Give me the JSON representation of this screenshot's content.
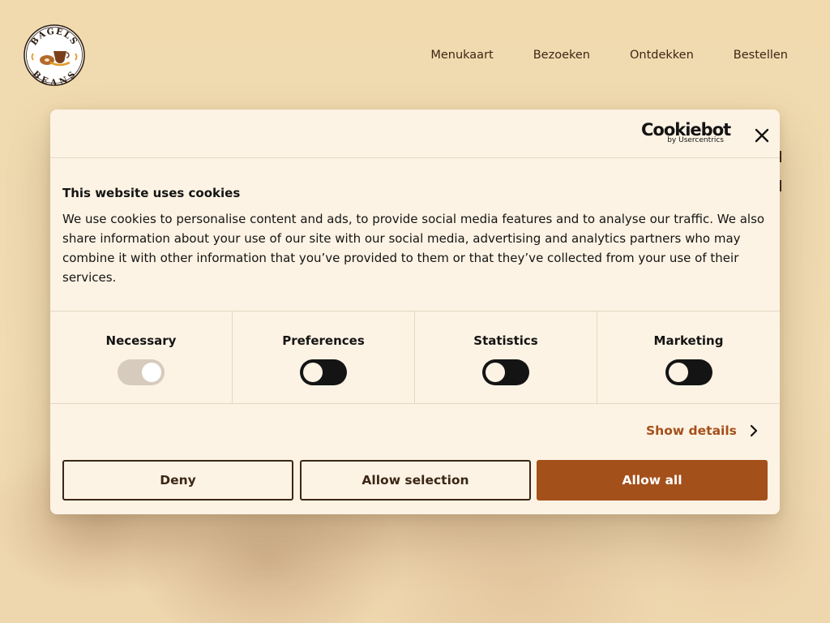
{
  "site": {
    "logo_text_top": "BAGELS",
    "logo_text_bottom": "BEANS",
    "nav": [
      "Menukaart",
      "Bezoeken",
      "Ontdekken",
      "Bestellen"
    ]
  },
  "dialog": {
    "provider_name": "Cookiebot",
    "provider_sub": "by Usercentrics",
    "title": "This website uses cookies",
    "description": "We use cookies to personalise content and ads, to provide social media features and to analyse our traffic. We also share information about your use of our site with our social media, advertising and analytics partners who may combine it with other information that you’ve provided to them or that they’ve collected from your use of their services.",
    "categories": [
      {
        "label": "Necessary",
        "checked": true,
        "disabled": true
      },
      {
        "label": "Preferences",
        "checked": false,
        "disabled": false
      },
      {
        "label": "Statistics",
        "checked": false,
        "disabled": false
      },
      {
        "label": "Marketing",
        "checked": false,
        "disabled": false
      }
    ],
    "show_details": "Show details",
    "buttons": {
      "deny": "Deny",
      "allow_selection": "Allow selection",
      "allow_all": "Allow all"
    }
  },
  "colors": {
    "page_bg": "#f1dcb1",
    "dialog_bg": "#fdf3e4",
    "accent": "#a4501b",
    "text_dark": "#3b2616"
  },
  "icons": {
    "close": "close-icon",
    "show_details": "chevron-right-icon",
    "logo": "bagels-beans-logo"
  }
}
